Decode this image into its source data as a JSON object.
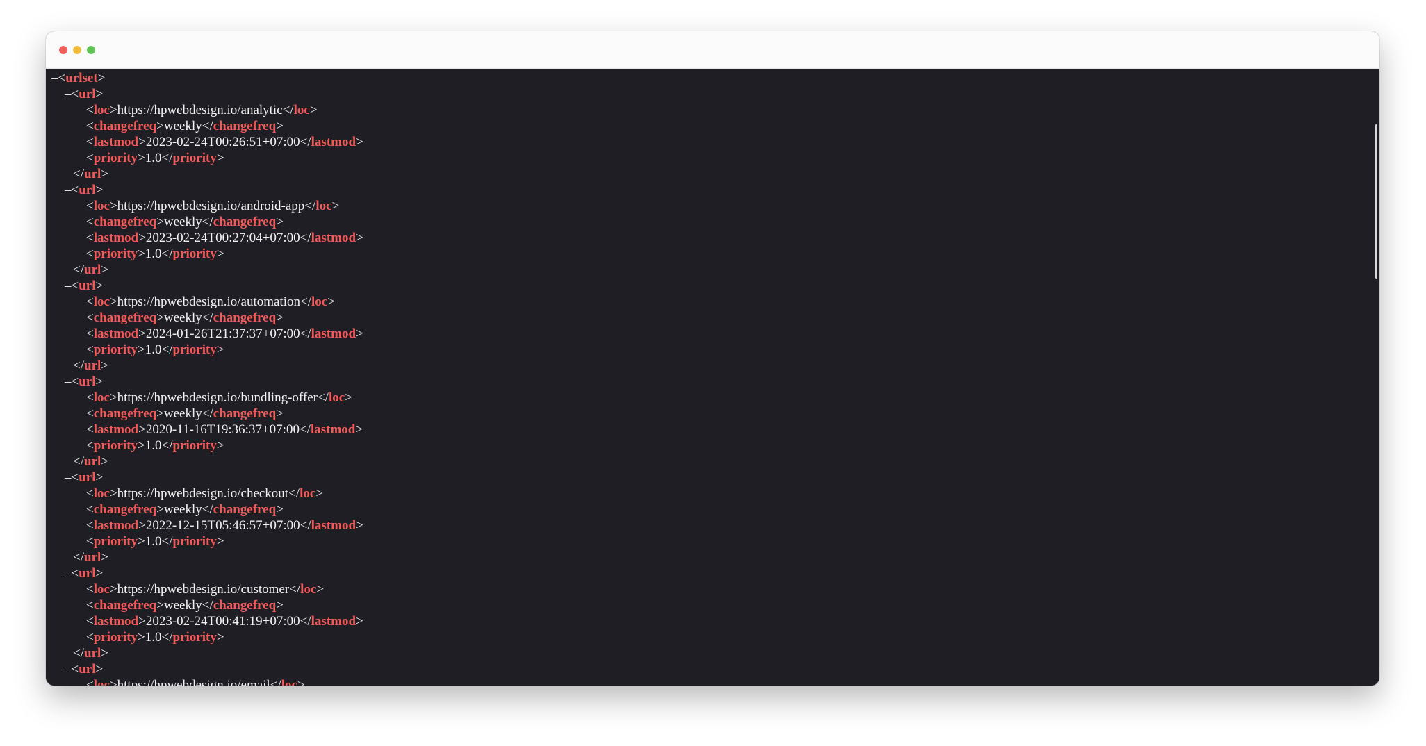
{
  "window": {
    "traffic_lights": [
      "close",
      "minimize",
      "zoom"
    ],
    "colors": {
      "close": "#ee5f5a",
      "minimize": "#f2bc3c",
      "zoom": "#5fc454",
      "tag": "#f25a5a",
      "background": "#1e1e24"
    }
  },
  "xml": {
    "root_tag": "urlset",
    "toggle": "–",
    "url_tag": "url",
    "field_tags": {
      "loc": "loc",
      "changefreq": "changefreq",
      "lastmod": "lastmod",
      "priority": "priority"
    },
    "urls": [
      {
        "loc": "https://hpwebdesign.io/analytic",
        "changefreq": "weekly",
        "lastmod": "2023-02-24T00:26:51+07:00",
        "priority": "1.0"
      },
      {
        "loc": "https://hpwebdesign.io/android-app",
        "changefreq": "weekly",
        "lastmod": "2023-02-24T00:27:04+07:00",
        "priority": "1.0"
      },
      {
        "loc": "https://hpwebdesign.io/automation",
        "changefreq": "weekly",
        "lastmod": "2024-01-26T21:37:37+07:00",
        "priority": "1.0"
      },
      {
        "loc": "https://hpwebdesign.io/bundling-offer",
        "changefreq": "weekly",
        "lastmod": "2020-11-16T19:36:37+07:00",
        "priority": "1.0"
      },
      {
        "loc": "https://hpwebdesign.io/checkout",
        "changefreq": "weekly",
        "lastmod": "2022-12-15T05:46:57+07:00",
        "priority": "1.0"
      },
      {
        "loc": "https://hpwebdesign.io/customer",
        "changefreq": "weekly",
        "lastmod": "2023-02-24T00:41:19+07:00",
        "priority": "1.0"
      },
      {
        "loc": "https://hpwebdesign.io/email",
        "changefreq": "",
        "lastmod": "",
        "priority": ""
      }
    ]
  }
}
